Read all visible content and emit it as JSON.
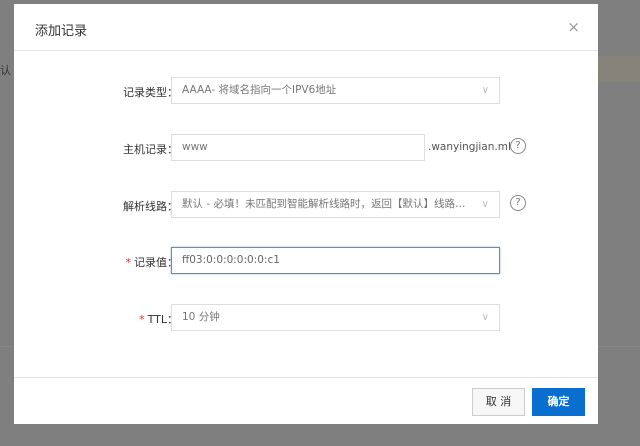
{
  "background": {
    "partial_text": "认"
  },
  "dialog": {
    "title": "添加记录",
    "close_icon": "×",
    "fields": {
      "record_type": {
        "label": "记录类型：",
        "value": "AAAA- 将域名指向一个IPV6地址"
      },
      "host": {
        "label": "主机记录：",
        "value": "www",
        "suffix": ".wanyingjian.ml"
      },
      "line": {
        "label": "解析线路：",
        "value": "默认 - 必填！未匹配到智能解析线路时，返回【默认】线路设置结果"
      },
      "value": {
        "required": "*",
        "label": "记录值：",
        "value": "ff03:0:0:0:0:0:0:c1"
      },
      "ttl": {
        "required": "*",
        "label": "TTL：",
        "value": "10 分钟"
      }
    },
    "help_icon": "?",
    "chevron": "∨",
    "buttons": {
      "cancel": "取 消",
      "ok": "确定"
    }
  }
}
